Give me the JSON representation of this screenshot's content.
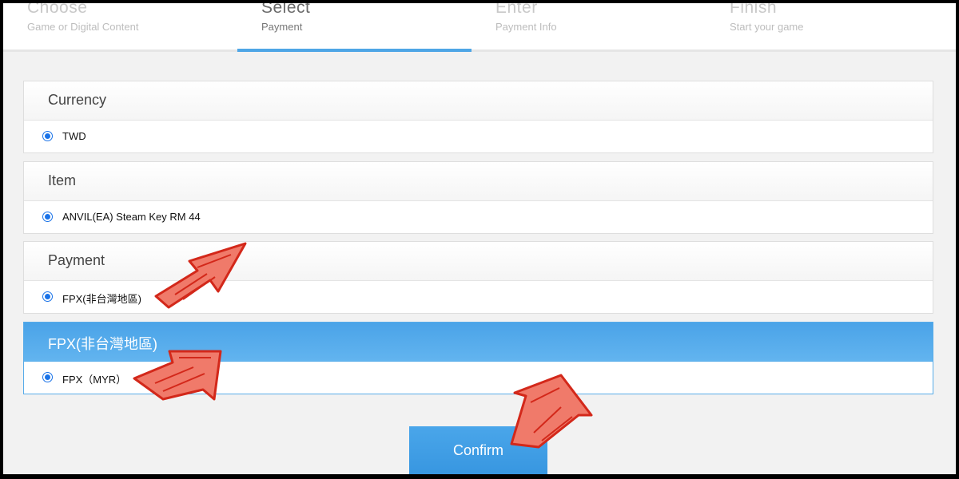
{
  "steps": [
    {
      "title": "Choose",
      "subtitle": "Game or Digital Content"
    },
    {
      "title": "Select",
      "subtitle": "Payment"
    },
    {
      "title": "Enter",
      "subtitle": "Payment Info"
    },
    {
      "title": "Finish",
      "subtitle": "Start your game"
    }
  ],
  "active_step": "Select",
  "sections": {
    "currency": {
      "header": "Currency",
      "option": "TWD"
    },
    "item": {
      "header": "Item",
      "option": "ANVIL(EA) Steam Key RM 44"
    },
    "payment": {
      "header": "Payment",
      "option": "FPX(非台灣地區)"
    },
    "fpx": {
      "header": "FPX(非台灣地區)",
      "option": "FPX（MYR）"
    }
  },
  "confirm_label": "Confirm",
  "colors": {
    "accent_blue": "#4ea6e6",
    "annotation_red": "#e03a2a",
    "page_bg": "#f2f2f2"
  },
  "annotations": [
    "arrow-icon",
    "arrow-icon",
    "arrow-icon"
  ]
}
